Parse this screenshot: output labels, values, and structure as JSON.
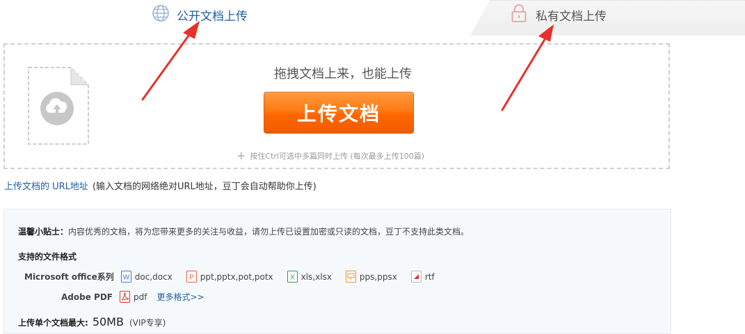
{
  "tabs": {
    "public": {
      "label": "公开文档上传",
      "icon": "globe-icon"
    },
    "private": {
      "label": "私有文档上传",
      "icon": "lock-icon"
    }
  },
  "dropzone": {
    "title": "拖拽文档上来，也能上传",
    "button_label": "上传文档",
    "hint": "按住Ctrl可选中多篇同时上传 (每次最多上传100篇)"
  },
  "url_upload": {
    "link": "上传文档的 URL地址",
    "description": "(输入文档的网络绝对URL地址，豆丁会自动帮助你上传)"
  },
  "tips": {
    "label": "温馨小贴士：",
    "text": "内容优秀的文档，将为您带来更多的关注与收益，请勿上传已设置加密或只读的文档，豆丁不支持此类文档。",
    "formats_title": "支持的文件格式",
    "office_group": "Microsoft office系列",
    "office_formats": [
      {
        "label": "doc,docx",
        "color": "#3a7bd5",
        "letter": "W"
      },
      {
        "label": "ppt,pptx,pot,potx",
        "color": "#e8613c",
        "letter": "P"
      },
      {
        "label": "xls,xlsx",
        "color": "#2e9a4c",
        "letter": "X"
      },
      {
        "label": "pps,ppsx",
        "color": "#e8902c",
        "letter": "P"
      },
      {
        "label": "rtf",
        "color": "#d33",
        "letter": ""
      }
    ],
    "pdf_group": "Adobe PDF",
    "pdf_format": {
      "label": "pdf",
      "color": "#d33"
    },
    "more_formats": "更多格式>>",
    "max_size_label": "上传单个文档最大:",
    "max_size_value": "50MB",
    "max_size_note": "(VIP专享)"
  },
  "colors": {
    "accent_orange": "#ff6600",
    "link_blue": "#1f5f9e",
    "arrow_red": "#e8302a"
  }
}
